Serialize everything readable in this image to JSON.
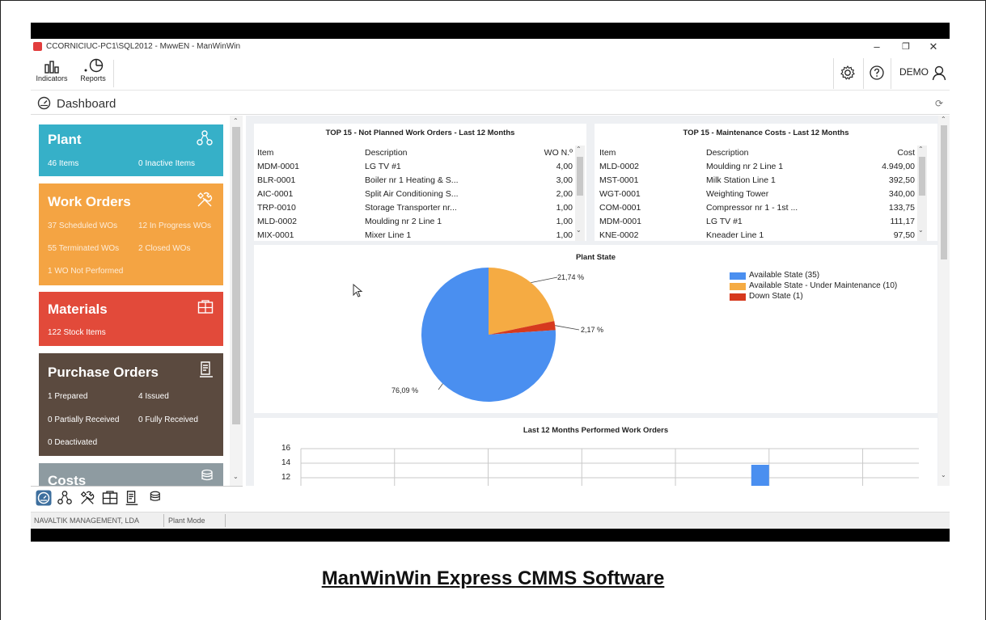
{
  "window": {
    "title": "CCORNICIUC-PC1\\SQL2012 - MwwEN - ManWinWin",
    "minimize": "–",
    "restore": "❐",
    "close": "✕"
  },
  "toolbar": {
    "indicators_label": "Indicators",
    "reports_label": "Reports",
    "user_label": "DEMO"
  },
  "dashboard": {
    "title": "Dashboard"
  },
  "tiles": {
    "plant": {
      "title": "Plant",
      "items": "46 Items",
      "inactive": "0 Inactive Items"
    },
    "work_orders": {
      "title": "Work Orders",
      "scheduled": "37 Scheduled WOs",
      "in_progress": "12 In Progress WOs",
      "terminated": "55 Terminated WOs",
      "closed": "2 Closed WOs",
      "not_performed": "1 WO Not Performed"
    },
    "materials": {
      "title": "Materials",
      "stock": "122 Stock Items"
    },
    "purchase_orders": {
      "title": "Purchase Orders",
      "prepared": "1 Prepared",
      "issued": "4 Issued",
      "partially_received": "0 Partially Received",
      "fully_received": "0 Fully Received",
      "deactivated": "0 Deactivated"
    },
    "costs": {
      "title": "Costs"
    }
  },
  "status_bar": {
    "company": "NAVALTIK MANAGEMENT, LDA",
    "mode": "Plant Mode"
  },
  "top_not_planned": {
    "title": "TOP 15 - Not Planned Work Orders - Last 12 Months",
    "headers": {
      "item": "Item",
      "description": "Description",
      "value": "WO N.º"
    },
    "rows": [
      {
        "item": "MDM-0001",
        "description": "LG TV #1",
        "value": "4,00"
      },
      {
        "item": "BLR-0001",
        "description": "Boiler nr 1 Heating & S...",
        "value": "3,00"
      },
      {
        "item": "AIC-0001",
        "description": "Split Air Conditioning S...",
        "value": "2,00"
      },
      {
        "item": "TRP-0010",
        "description": "Storage Transporter nr...",
        "value": "1,00"
      },
      {
        "item": "MLD-0002",
        "description": "Moulding nr 2 Line 1",
        "value": "1,00"
      },
      {
        "item": "MIX-0001",
        "description": "Mixer Line 1",
        "value": "1,00"
      }
    ]
  },
  "top_costs": {
    "title": "TOP 15 - Maintenance Costs - Last 12 Months",
    "headers": {
      "item": "Item",
      "description": "Description",
      "value": "Cost"
    },
    "rows": [
      {
        "item": "MLD-0002",
        "description": "Moulding nr 2 Line 1",
        "value": "4.949,00"
      },
      {
        "item": "MST-0001",
        "description": "Milk Station Line 1",
        "value": "392,50"
      },
      {
        "item": "WGT-0001",
        "description": "Weighting Tower",
        "value": "340,00"
      },
      {
        "item": "COM-0001",
        "description": "Compressor nr 1 - 1st ...",
        "value": "133,75"
      },
      {
        "item": "MDM-0001",
        "description": "LG TV #1",
        "value": "111,17"
      },
      {
        "item": "KNE-0002",
        "description": "Kneader Line 1",
        "value": "97,50"
      }
    ]
  },
  "chart_data": [
    {
      "type": "pie",
      "title": "Plant State",
      "series": [
        {
          "name": "Available State (35)",
          "value": 35,
          "percent_label": "76,09 %",
          "color": "#4a8ff0"
        },
        {
          "name": "Available State - Under Maintenance (10)",
          "value": 10,
          "percent_label": "21,74 %",
          "color": "#f5ab43"
        },
        {
          "name": "Down State (1)",
          "value": 1,
          "percent_label": "2,17 %",
          "color": "#d6391e"
        }
      ],
      "legend": "right"
    },
    {
      "type": "bar",
      "title": "Last 12 Months Performed Work Orders",
      "yticks": [
        "16",
        "14",
        "12"
      ],
      "grid": true,
      "bar_color": "#4a8ff0"
    }
  ]
}
